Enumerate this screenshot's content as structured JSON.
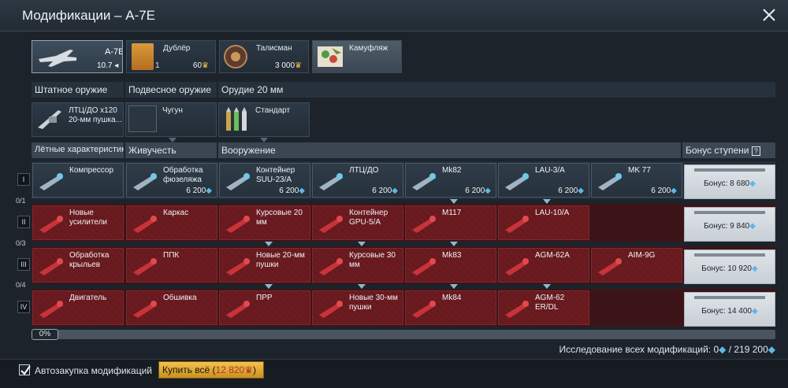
{
  "window": {
    "title": "Модификации – А-7E"
  },
  "top_cards": [
    {
      "label": "А-7E",
      "sub": "10.7",
      "sub_icon": "rank-arrow-icon"
    },
    {
      "label": "Дублёр",
      "left_value": "1",
      "price": "60",
      "currency": "golden-eagle-icon"
    },
    {
      "label": "Талисман",
      "price": "3 000",
      "currency": "golden-eagle-icon"
    },
    {
      "label": "Камуфляж"
    }
  ],
  "weapon_headers": [
    "Штатное оружие",
    "Подвесное оружие",
    "Орудие 20 мм"
  ],
  "weapon_cards": [
    {
      "label": "ЛТЦ/ДО x120\n20-мм пушка..."
    },
    {
      "label": "Чугун"
    },
    {
      "label": "Стандарт"
    }
  ],
  "category_headers": [
    "Лётные характеристики",
    "Живучесть",
    "Вооружение",
    "Бонус ступени"
  ],
  "ranks": [
    {
      "roman": "I",
      "fraction": "0/1",
      "bonus": "Бонус: 8 680"
    },
    {
      "roman": "II",
      "fraction": "0/3",
      "bonus": "Бонус: 9 840"
    },
    {
      "roman": "III",
      "fraction": "0/4",
      "bonus": "Бонус: 10 920"
    },
    {
      "roman": "IV",
      "fraction": "",
      "bonus": "Бонус: 14 400"
    }
  ],
  "mods": [
    [
      {
        "title": "Компрессор",
        "price": ""
      },
      {
        "title": "Обработка фюзеляжа",
        "price": "6 200"
      },
      {
        "title": "Контейнер SUU-23/A",
        "price": "6 200"
      },
      {
        "title": "ЛТЦ/ДО",
        "price": "6 200"
      },
      {
        "title": "Mk82",
        "price": "6 200"
      },
      {
        "title": "LAU-3/A",
        "price": "6 200"
      },
      {
        "title": "MK 77",
        "price": "6 200"
      }
    ],
    [
      {
        "title": "Новые усилители"
      },
      {
        "title": "Каркас"
      },
      {
        "title": "Курсовые 20 мм"
      },
      {
        "title": "Контейнер GPU-5/A"
      },
      {
        "title": "M117"
      },
      {
        "title": "LAU-10/A"
      },
      null
    ],
    [
      {
        "title": "Обработка крыльев"
      },
      {
        "title": "ППК"
      },
      {
        "title": "Новые 20-мм пушки"
      },
      {
        "title": "Курсовые 30 мм"
      },
      {
        "title": "Mk83"
      },
      {
        "title": "AGM-62A"
      },
      {
        "title": "AIM-9G"
      }
    ],
    [
      {
        "title": "Двигатель"
      },
      {
        "title": "Обшивка"
      },
      {
        "title": "ПРР"
      },
      {
        "title": "Новые 30-мм пушки"
      },
      {
        "title": "Mk84"
      },
      {
        "title": "AGM-62 ER/DL"
      },
      null
    ]
  ],
  "progress": {
    "label": "0%",
    "value": 0
  },
  "research": {
    "text": "Исследование всех модификаций: 0",
    "total": "/ 219 200"
  },
  "footer": {
    "auto_label": "Автозакупка модификаций",
    "buy_label": "Купить всё (",
    "buy_price": "12 820",
    "buy_close": ")"
  },
  "colors": {
    "research_points": "#5fb6e8",
    "golden_eagles": "#f6c23e",
    "locked_mod": "#6e1b20"
  }
}
